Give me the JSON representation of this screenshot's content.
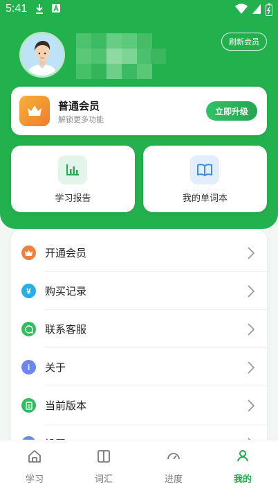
{
  "status_bar": {
    "time": "5:41"
  },
  "profile": {
    "refresh_label": "刷新会员"
  },
  "member": {
    "title": "普通会员",
    "subtitle": "解锁更多功能",
    "upgrade_label": "立即升级"
  },
  "features": [
    {
      "label": "学习报告",
      "icon": "bar-chart-icon"
    },
    {
      "label": "我的单词本",
      "icon": "open-book-icon"
    }
  ],
  "menu": [
    {
      "label": "开通会员",
      "icon": "crown-icon",
      "color": "#f47f3a"
    },
    {
      "label": "购买记录",
      "icon": "yen-icon",
      "color": "#27aee8"
    },
    {
      "label": "联系客服",
      "icon": "chat-icon",
      "color": "#2fbe5f"
    },
    {
      "label": "关于",
      "icon": "info-icon",
      "color": "#6b86f0"
    },
    {
      "label": "当前版本",
      "icon": "document-icon",
      "color": "#2fbe5f"
    },
    {
      "label": "设置",
      "icon": "gear-icon",
      "color": "#6b86f0"
    }
  ],
  "tabs": [
    {
      "label": "学习",
      "icon": "home-icon",
      "active": false
    },
    {
      "label": "词汇",
      "icon": "book-icon",
      "active": false
    },
    {
      "label": "进度",
      "icon": "gauge-icon",
      "active": false
    },
    {
      "label": "我的",
      "icon": "user-icon",
      "active": true
    }
  ],
  "colors": {
    "brand": "#22b14c",
    "upgrade": "#2ab25a",
    "active_tab": "#22a84a"
  }
}
